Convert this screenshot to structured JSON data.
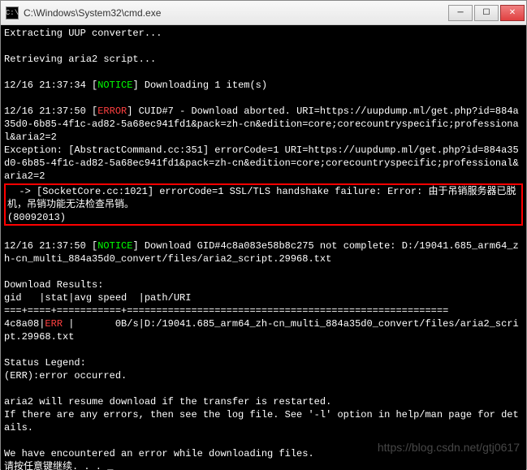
{
  "titlebar": {
    "icon_label": "C:\\",
    "title": "C:\\Windows\\System32\\cmd.exe",
    "min": "─",
    "max": "☐",
    "close": "✕"
  },
  "term": {
    "line_extract": "Extracting UUP converter...",
    "line_retrieve": "Retrieving aria2 script...",
    "ts1": "12/16 21:37:34",
    "notice": "NOTICE",
    "dl1": " Downloading 1 item(s)",
    "ts2": "12/16 21:37:50",
    "error": "ERROR",
    "abort": " CUID#7 - Download aborted. URI=https://uupdump.ml/get.php?id=884a35d0-6b85-4f1c-ad82-5a68ec941fd1&pack=zh-cn&edition=core;corecountryspecific;professional&aria2=2",
    "exception": "Exception: [AbstractCommand.cc:351] errorCode=1 URI=https://uupdump.ml/get.php?id=884a35d0-6b85-4f1c-ad82-5a68ec941fd1&pack=zh-cn&edition=core;corecountryspecific;professional&aria2=2",
    "ssl_err": "  -> [SocketCore.cc:1021] errorCode=1 SSL/TLS handshake failure: Error: 由于吊销服务器已脱机，吊销功能无法检查吊销。\n(80092013)",
    "ts3": "12/16 21:37:50",
    "gid_nc": " Download GID#4c8a083e58b8c275 not complete: D:/19041.685_arm64_zh-cn_multi_884a35d0_convert/files/aria2_script.29968.txt",
    "dlres": "Download Results:",
    "dlhdr": "gid   |stat|avg speed  |path/URI",
    "sep": "===+====+===========+=======================================================",
    "gid": "4c8a08|",
    "err": "ERR",
    "row_rest": " |       0B/s|D:/19041.685_arm64_zh-cn_multi_884a35d0_convert/files/aria2_script.29968.txt",
    "status_legend": "Status Legend:",
    "err_occurred": "(ERR):error occurred.",
    "resume": "aria2 will resume download if the transfer is restarted.",
    "log_hint": "If there are any errors, then see the log file. See '-l' option in help/man page for details.",
    "enc_err": "We have encountered an error while downloading files.",
    "press_any": "请按任意键继续. . . ",
    "cursor": "_"
  },
  "watermark": "https://blog.csdn.net/gtj0617"
}
